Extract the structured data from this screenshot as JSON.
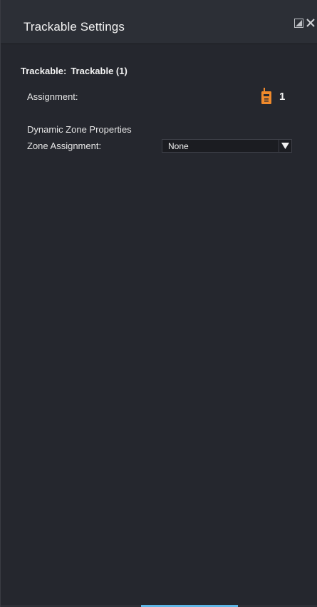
{
  "header": {
    "title": "Trackable Settings",
    "icons": [
      "undock-icon",
      "close-icon"
    ]
  },
  "trackable": {
    "label": "Trackable:",
    "name": "Trackable (1)"
  },
  "assignment": {
    "label": "Assignment:",
    "icon": "tag-device-icon",
    "count": "1",
    "icon_color": "#f08a2c"
  },
  "dynamic_zone": {
    "section_label": "Dynamic Zone Properties",
    "zone_assignment_label": "Zone Assignment:",
    "zone_assignment_value": "None"
  },
  "colors": {
    "background": "#25272e",
    "header": "#2c2f36",
    "accent": "#5fb6e6",
    "tag_orange": "#f08a2c"
  }
}
